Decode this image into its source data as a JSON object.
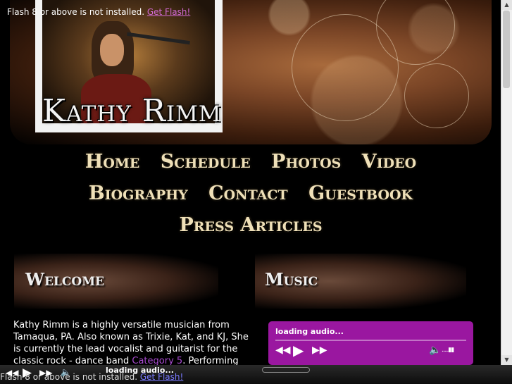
{
  "header": {
    "flash_notice": "Flash 8 or above is not installed.",
    "get_flash": "Get Flash!",
    "site_title": "Kathy Rimm"
  },
  "nav": {
    "row1": [
      "Home",
      "Schedule",
      "Photos",
      "Video"
    ],
    "row2": [
      "Biography",
      "Contact",
      "Guestbook"
    ],
    "row3": [
      "Press Articles"
    ]
  },
  "welcome": {
    "heading": "Welcome",
    "text_before_link": "Kathy Rimm is a highly versatile musician from Tamaqua, PA.  Also known as Trixie, Kat, and KJ, She is currently the lead vocalist and guitarist for the classic rock - dance band ",
    "link": "Category 5",
    "text_after_link": ".  Performing solo is a"
  },
  "music": {
    "heading": "Music",
    "player_status": "loading audio..."
  },
  "bottom_bar": {
    "player_status": "loading audio...",
    "flash_notice": "Flash 8 or above is not installed.",
    "get_flash": "Get Flash!"
  },
  "colors": {
    "player_bg": "#9a17a0",
    "nav_text": "#efe0b8",
    "link": "#a84ad0"
  }
}
